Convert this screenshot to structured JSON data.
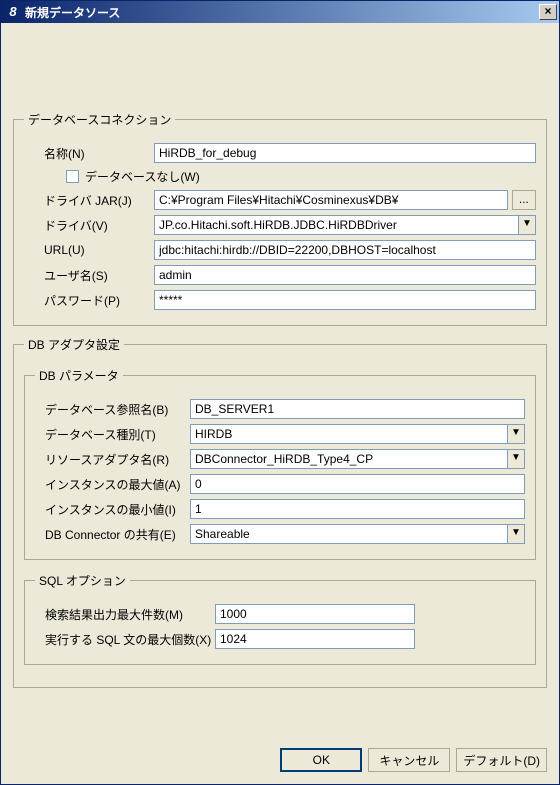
{
  "window": {
    "icon_text": "8",
    "title": "新規データソース",
    "close_glyph": "×"
  },
  "groups": {
    "db_connection": {
      "legend": "データベースコネクション",
      "name_label": "名称(N)",
      "name_value": "HiRDB_for_debug",
      "no_database_label": "データベースなし(W)",
      "driver_jar_label": "ドライバ JAR(J)",
      "driver_jar_value": "C:¥Program Files¥Hitachi¥Cosminexus¥DB¥",
      "browse_label": "...",
      "driver_label": "ドライバ(V)",
      "driver_value": "JP.co.Hitachi.soft.HiRDB.JDBC.HiRDBDriver",
      "url_label": "URL(U)",
      "url_value": "jdbc:hitachi:hirdb://DBID=22200,DBHOST=localhost",
      "user_label": "ユーザ名(S)",
      "user_value": "admin",
      "password_label": "パスワード(P)",
      "password_value": "*****"
    },
    "db_adapter": {
      "legend": "DB アダプタ設定",
      "params_legend": "DB パラメータ",
      "ref_name_label": "データベース参照名(B)",
      "ref_name_value": "DB_SERVER1",
      "db_type_label": "データベース種別(T)",
      "db_type_value": "HIRDB",
      "resource_adapter_label": "リソースアダプタ名(R)",
      "resource_adapter_value": "DBConnector_HiRDB_Type4_CP",
      "instance_max_label": "インスタンスの最大値(A)",
      "instance_max_value": "0",
      "instance_min_label": "インスタンスの最小値(I)",
      "instance_min_value": "1",
      "connector_share_label": "DB Connector の共有(E)",
      "connector_share_value": "Shareable"
    },
    "sql_options": {
      "legend": "SQL オプション",
      "max_results_label": "検索結果出力最大件数(M)",
      "max_results_value": "1000",
      "max_sql_label": "実行する SQL 文の最大個数(X)",
      "max_sql_value": "1024"
    }
  },
  "buttons": {
    "ok": "OK",
    "cancel": "キャンセル",
    "default": "デフォルト(D)"
  },
  "glyphs": {
    "dropdown_arrow": "▼"
  }
}
